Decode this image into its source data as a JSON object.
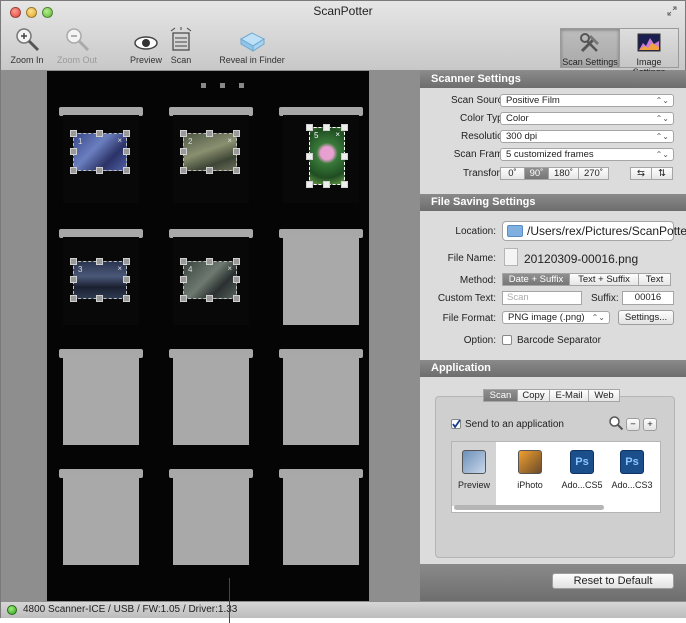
{
  "window": {
    "title": "ScanPotter"
  },
  "toolbar": {
    "zoom_in": "Zoom In",
    "zoom_out": "Zoom Out",
    "preview": "Preview",
    "scan": "Scan",
    "reveal": "Reveal in Finder",
    "scan_settings": "Scan Settings",
    "image_settings": "Image Settings"
  },
  "frames": [
    {
      "num": "1",
      "close": "×"
    },
    {
      "num": "2",
      "close": "×"
    },
    {
      "num": "5",
      "close": "×"
    },
    {
      "num": "3",
      "close": "×"
    },
    {
      "num": "4",
      "close": "×"
    }
  ],
  "scanner_settings": {
    "heading": "Scanner Settings",
    "scan_source_label": "Scan Source:",
    "scan_source": "Positive Film",
    "color_type_label": "Color Type:",
    "color_type": "Color",
    "resolution_label": "Resolution:",
    "resolution": "300 dpi",
    "scan_frame_label": "Scan Frame:",
    "scan_frame": "5 customized frames",
    "transform_label": "Transform:",
    "rotations": [
      "0˚",
      "90˚",
      "180˚",
      "270˚"
    ]
  },
  "file_saving": {
    "heading": "File Saving Settings",
    "location_label": "Location:",
    "location": "/Users/rex/Pictures/ScanPotter",
    "file_name_label": "File Name:",
    "file_name": "20120309-00016.png",
    "method_label": "Method:",
    "methods": [
      "Date + Suffix",
      "Text + Suffix",
      "Text"
    ],
    "custom_text_label": "Custom Text:",
    "custom_text_placeholder": "Scan",
    "suffix_label": "Suffix:",
    "suffix": "00016",
    "file_format_label": "File Format:",
    "file_format": "PNG image (.png)",
    "settings_button": "Settings...",
    "option_label": "Option:",
    "barcode_separator": "Barcode Separator"
  },
  "application": {
    "heading": "Application",
    "tabs": [
      "Scan",
      "Copy",
      "E-Mail",
      "Web"
    ],
    "send_to_app": "Send to an application",
    "apps": [
      "Preview",
      "iPhoto",
      "Ado...CS5",
      "Ado...CS3"
    ],
    "ps_label": "Ps",
    "minus": "−",
    "plus": "+"
  },
  "reset_button": "Reset to Default",
  "status": "4800 Scanner-ICE / USB / FW:1.05 / Driver:1.33",
  "arrows": "⌃⌄"
}
